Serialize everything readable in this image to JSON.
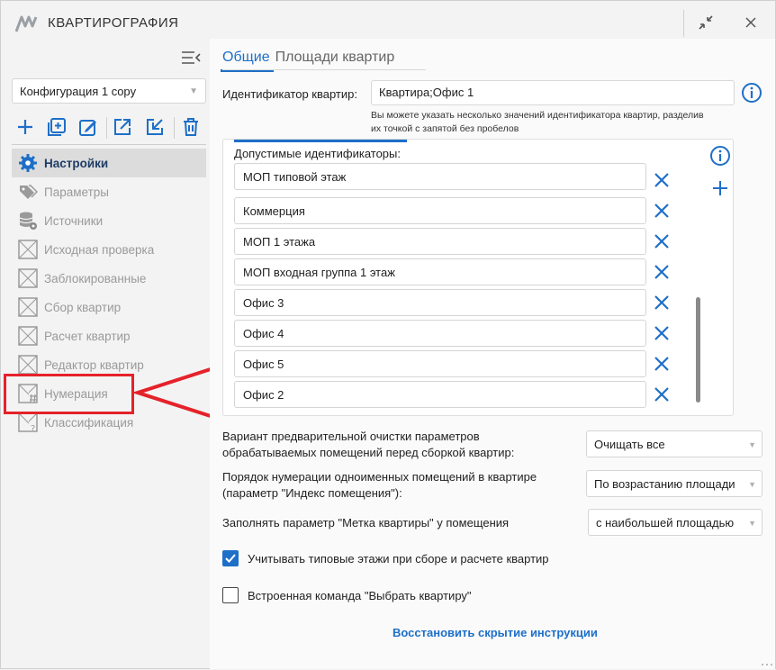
{
  "window": {
    "title": "КВАРТИРОГРАФИЯ",
    "icons": [
      "app-logo-icon",
      "minimize-arrows-icon",
      "close-icon"
    ]
  },
  "sidebar": {
    "config_select": "Конфигурация 1 copy",
    "toolbar_icons": [
      "add-icon",
      "add-copy-icon",
      "edit-icon",
      "export-icon",
      "import-icon",
      "delete-icon"
    ],
    "items": [
      {
        "label": "Настройки",
        "icon": "gear-icon",
        "active": true
      },
      {
        "label": "Параметры",
        "icon": "tags-icon"
      },
      {
        "label": "Источники",
        "icon": "database-icon"
      },
      {
        "label": "Исходная проверка",
        "icon": "check-square-icon"
      },
      {
        "label": "Заблокированные",
        "icon": "lock-square-icon"
      },
      {
        "label": "Сбор квартир",
        "icon": "gather-square-icon"
      },
      {
        "label": "Расчет квартир",
        "icon": "calc-square-icon"
      },
      {
        "label": "Редактор квартир",
        "icon": "edit-square-icon"
      },
      {
        "label": "Нумерация",
        "icon": "hash-square-icon"
      },
      {
        "label": "Классификация",
        "icon": "question-square-icon"
      }
    ]
  },
  "main": {
    "tabs": [
      {
        "label": "Общие",
        "active": true
      },
      {
        "label": "Площади квартир"
      }
    ],
    "identifier": {
      "label": "Идентификатор квартир:",
      "value": "Квартира;Офис 1",
      "hint_line1": "Вы можете указать несколько значений идентификатора квартир, разделив",
      "hint_line2": "их точкой с запятой без пробелов"
    },
    "allowed_ids": {
      "label": "Допустимые идентификаторы:",
      "items": [
        "МОП типовой этаж",
        "Коммерция",
        "МОП 1 этажа",
        "МОП входная группа 1 этаж",
        "Офис 3",
        "Офис 4",
        "Офис 5",
        "Офис 2"
      ]
    },
    "cleanup": {
      "label_line1": "Вариант предварительной очистки параметров",
      "label_line2": "обрабатываемых помещений перед сборкой квартир:",
      "value": "Очищать все"
    },
    "numbering": {
      "label_line1": "Порядок нумерации одноименных помещений в квартире",
      "label_line2": "(параметр \"Индекс помещения\"):",
      "value": "По возрастанию площади"
    },
    "mark": {
      "label": "Заполнять параметр \"Метка квартиры\" у помещения",
      "value": "с наибольшей площадью"
    },
    "typical_floors": {
      "label": "Учитывать типовые этажи при сборе и расчете квартир",
      "checked": true
    },
    "builtin_command": {
      "label": "Встроенная команда \"Выбрать квартиру\"",
      "checked": false
    },
    "restore_link": "Восстановить скрытие инструкции"
  },
  "colors": {
    "accent": "#1e6fc8",
    "highlight": "#e5222a",
    "active_nav": "#1f3c66"
  }
}
